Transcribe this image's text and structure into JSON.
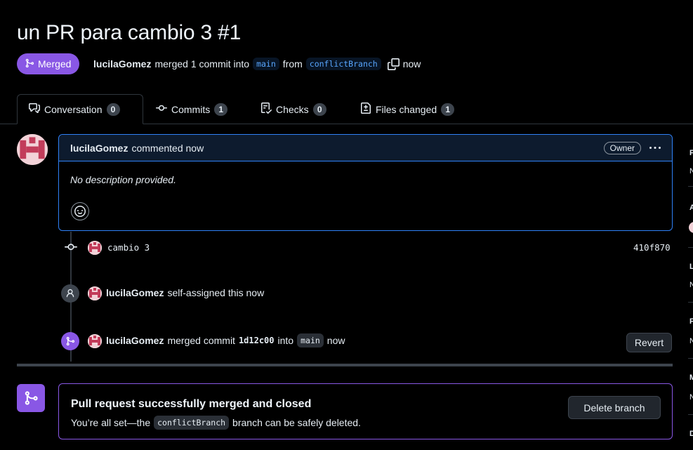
{
  "pr": {
    "title": "un PR para cambio 3 #1",
    "state": "Merged",
    "author": "lucilaGomez",
    "summary_verb": "merged 1 commit into",
    "base_branch": "main",
    "from_word": "from",
    "head_branch": "conflictBranch",
    "time": "now"
  },
  "tabs": [
    {
      "label": "Conversation",
      "count": "0"
    },
    {
      "label": "Commits",
      "count": "1"
    },
    {
      "label": "Checks",
      "count": "0"
    },
    {
      "label": "Files changed",
      "count": "1"
    }
  ],
  "comment": {
    "author": "lucilaGomez",
    "action": "commented now",
    "role": "Owner",
    "body": "No description provided."
  },
  "timeline": {
    "commit": {
      "message": "cambio 3",
      "sha": "410f870"
    },
    "assign": {
      "actor": "lucilaGomez",
      "text": "self-assigned this now"
    },
    "merge": {
      "actor": "lucilaGomez",
      "verb": "merged commit",
      "sha": "1d12c00",
      "into": "into",
      "branch": "main",
      "time": "now",
      "revert_label": "Revert"
    }
  },
  "merge_box": {
    "title": "Pull request successfully merged and closed",
    "sub_prefix": "You’re all set—the",
    "branch": "conflictBranch",
    "sub_suffix": "branch can be safely deleted.",
    "delete_label": "Delete branch"
  },
  "sidebar_letters": [
    "F",
    "N",
    "A",
    "L",
    "N",
    "F",
    "N",
    "M",
    "N",
    "D"
  ],
  "colors": {
    "merged": "#8957e5",
    "accent_blue": "#2f81f7",
    "border": "#30363d",
    "background": "#000000"
  }
}
